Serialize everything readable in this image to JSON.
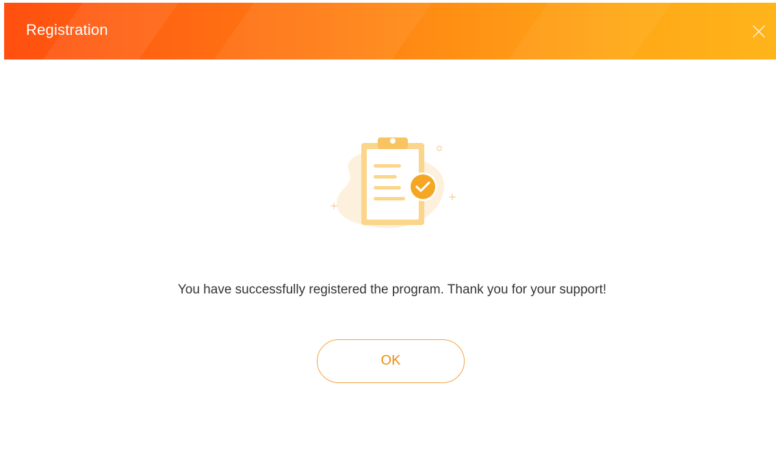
{
  "window": {
    "title": "Registration",
    "close_icon": "close-icon"
  },
  "main": {
    "illustration_icon": "clipboard-check-icon",
    "message": "You have successfully registered the program. Thank you for your support!",
    "ok_label": "OK"
  },
  "colors": {
    "header_gradient_start": "#ff4f10",
    "header_gradient_end": "#ffb41a",
    "accent": "#f08a10",
    "button_border": "#f2a23c",
    "text": "#333333"
  }
}
